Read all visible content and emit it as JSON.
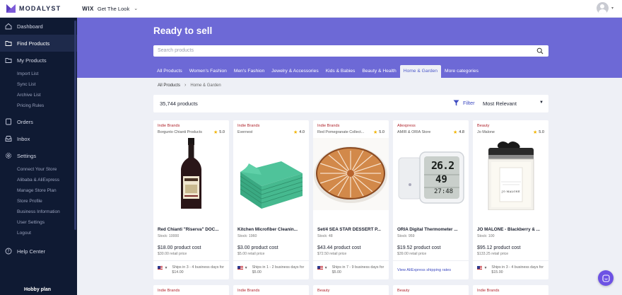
{
  "header": {
    "logo_text": "MODALYST",
    "wix_brand": "WIX",
    "site_name": "Get The Look"
  },
  "sidebar": {
    "dashboard": "Dashboard",
    "find_products": "Find Products",
    "my_products": "My Products",
    "my_products_sub": [
      "Import List",
      "Sync List",
      "Archive List",
      "Pricing Rules"
    ],
    "orders": "Orders",
    "inbox": "Inbox",
    "settings": "Settings",
    "settings_sub": [
      "Connect Your Store",
      "Alibaba & AliExpress",
      "Manage Store Plan",
      "Store Profile",
      "Business Information",
      "User Settings",
      "Logout"
    ],
    "help_center": "Help Center",
    "plan": "Hobby plan"
  },
  "hero": {
    "title": "Ready to sell",
    "search_placeholder": "Search products",
    "tabs": [
      "All Products",
      "Women's Fashion",
      "Men's Fashion",
      "Jewelry & Accessories",
      "Kids & Babies",
      "Beauty & Health",
      "Home & Garden",
      "More categories"
    ],
    "active_tab": "Home & Garden"
  },
  "breadcrumb": {
    "root": "All Products",
    "current": "Home & Garden"
  },
  "results": {
    "count": "35,744 products",
    "filter_label": "Filter",
    "sort_value": "Most Relevant"
  },
  "products": [
    {
      "source": "Indie Brands",
      "shop": "Borgunto Chianti Products",
      "rating": "5.0",
      "title": "Red Chianti \"Riserva\" DOC...",
      "stock": "Stock: 10000",
      "cost": "$18.00 product cost",
      "retail": "$30.00 retail price",
      "shipping": "Ships in 3 - 4 business days for $14.00",
      "image": "wine-bottle-icon"
    },
    {
      "source": "Indie Brands",
      "shop": "Evernest",
      "rating": "4.0",
      "title": "Kitchen Microfiber Cleanin...",
      "stock": "Stock: 1960",
      "cost": "$3.00 product cost",
      "retail": "$5.00 retail price",
      "shipping": "Ships in 1 - 2 business days for $5.00",
      "image": "microfiber-cloths-icon"
    },
    {
      "source": "Indie Brands",
      "shop": "Red Pomegranate Collect...",
      "rating": "5.0",
      "title": "Set/4 SEA STAR DESSERT P...",
      "stock": "Stock: 48",
      "cost": "$43.44 product cost",
      "retail": "$72.50 retail price",
      "shipping": "Ships in 7 - 9 business days for $5.00",
      "image": "dessert-plate-icon"
    },
    {
      "source": "Aliexpress",
      "shop": "AMIR & ORIA Store",
      "rating": "4.8",
      "title": "ORIA Digital Thermometer ...",
      "stock": "Stock: 959",
      "cost": "$19.52 product cost",
      "retail": "$39.00 retail price",
      "shipping_link": "View AliExpress shipping rates",
      "thermo_temp": "26.2",
      "thermo_hum": "49",
      "thermo_time": "27:48",
      "image": "thermometer-icon"
    },
    {
      "source": "Beauty",
      "shop": "Jo Malone",
      "rating": "5.0",
      "title": "JO MALONE - Blackberry & ...",
      "stock": "Stock: 100",
      "cost": "$95.12 product cost",
      "retail": "$133.25 retail price",
      "shipping": "Ships in 3 - 4 business days for $15.00",
      "candle_label": "JO MALONE",
      "image": "candle-jar-icon"
    }
  ],
  "next_row_sources": [
    "Indie Brands",
    "Indie Brands",
    "Beauty",
    "Beauty",
    "Indie Brands"
  ],
  "colors": {
    "hero": "#6d69d6",
    "sidebar": "#0f1a33",
    "accent": "#3e4bc1",
    "source_label": "#b0252d",
    "star": "#f2b400"
  }
}
